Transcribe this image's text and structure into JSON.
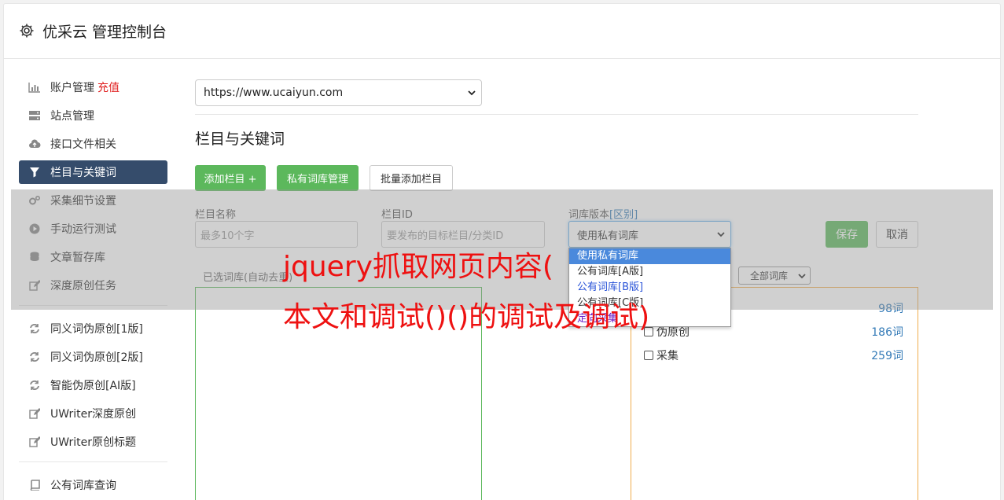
{
  "header": {
    "title": "优采云 管理控制台",
    "icon": "gear-icon"
  },
  "sidebar": {
    "items": [
      {
        "label": "账户管理",
        "icon": "bar-chart-icon",
        "extra": "充值"
      },
      {
        "label": "站点管理",
        "icon": "server-icon"
      },
      {
        "label": "接口文件相关",
        "icon": "cloud-upload-icon"
      },
      {
        "label": "栏目与关键词",
        "icon": "filter-icon",
        "active": true
      },
      {
        "label": "采集细节设置",
        "icon": "cogs-icon"
      },
      {
        "label": "手动运行测试",
        "icon": "play-icon"
      },
      {
        "label": "文章暂存库",
        "icon": "database-icon"
      },
      {
        "label": "深度原创任务",
        "icon": "edit-icon"
      }
    ],
    "items2": [
      {
        "label": "同义词伪原创[1版]",
        "icon": "refresh-icon"
      },
      {
        "label": "同义词伪原创[2版]",
        "icon": "refresh-icon"
      },
      {
        "label": "智能伪原创[AI版]",
        "icon": "refresh-icon"
      },
      {
        "label": "UWriter深度原创",
        "icon": "edit-icon"
      },
      {
        "label": "UWriter原创标题",
        "icon": "edit-icon"
      }
    ],
    "items3": [
      {
        "label": "公有词库查询",
        "icon": "book-icon"
      }
    ]
  },
  "main": {
    "site_select": "https://www.ucaiyun.com",
    "section_title": "栏目与关键词",
    "buttons": {
      "add_column": "添加栏目 +",
      "private_lib": "私有词库管理",
      "batch_add": "批量添加栏目"
    },
    "form": {
      "name_label": "栏目名称",
      "name_placeholder": "最多10个字",
      "id_label": "栏目ID",
      "id_placeholder": "要发布的目标栏目/分类ID",
      "lib_label": "词库版本",
      "lib_label_link": "[区别]",
      "lib_value": "使用私有词库",
      "save": "保存",
      "cancel": "取消"
    },
    "lib_options": [
      "使用私有词库",
      "公有词库[A版]",
      "公有词库[B版]",
      "公有词库[C版]",
      "定向采集"
    ],
    "left_label": "已选词库(自动去重)",
    "all_select": "全部词库",
    "word_rows": [
      {
        "label": "",
        "count": "98词"
      },
      {
        "label": "伪原创",
        "count": "186词"
      },
      {
        "label": "采集",
        "count": "259词"
      }
    ]
  },
  "watermark": {
    "line1": "jquery抓取网页内容(",
    "line2": "本文和调试()()的调试及调试)"
  },
  "colors": {
    "active_nav": "#354c6b",
    "green": "#5cb85c",
    "watermark": "#ee1111"
  }
}
